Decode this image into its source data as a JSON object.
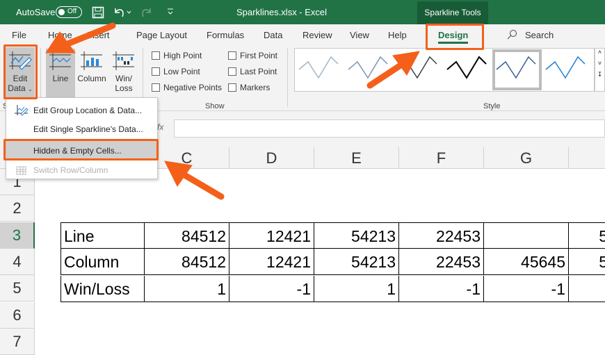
{
  "titlebar": {
    "autosave_label": "AutoSave",
    "autosave_state": "Off",
    "file_title": "Sparklines.xlsx  -  Excel",
    "context_tab": "Sparkline Tools"
  },
  "tabs": [
    {
      "label": "File"
    },
    {
      "label": "Home"
    },
    {
      "label": "Insert"
    },
    {
      "label": "Page Layout"
    },
    {
      "label": "Formulas"
    },
    {
      "label": "Data"
    },
    {
      "label": "Review"
    },
    {
      "label": "View"
    },
    {
      "label": "Help"
    },
    {
      "label": "Design",
      "active": true
    }
  ],
  "search": {
    "label": "Search"
  },
  "ribbon": {
    "edit_data": {
      "line1": "Edit",
      "line2": "Data"
    },
    "type": {
      "line": "Line",
      "column": "Column",
      "winloss1": "Win/",
      "winloss2": "Loss"
    },
    "show": {
      "label": "Show",
      "options": [
        {
          "label": "High Point",
          "checked": false
        },
        {
          "label": "Low Point",
          "checked": false
        },
        {
          "label": "Negative Points",
          "checked": false
        },
        {
          "label": "First Point",
          "checked": false
        },
        {
          "label": "Last Point",
          "checked": false
        },
        {
          "label": "Markers",
          "checked": false
        }
      ]
    },
    "style": {
      "label": "Style",
      "swatch_colors": [
        "#a2b6c6",
        "#7b96b0",
        "#404040",
        "#000000",
        "#3b5f94",
        "#1f7fd0"
      ],
      "selected_index": 4
    },
    "group_label_partial": "S"
  },
  "menu": {
    "items": [
      {
        "label": "Edit Group Location & Data...",
        "icon": "edit-sparkline-icon",
        "enabled": true
      },
      {
        "label": "Edit Single Sparkline's Data...",
        "enabled": true
      },
      {
        "label": "Hidden & Empty Cells...",
        "enabled": true,
        "highlighted": true
      },
      {
        "label": "Switch Row/Column",
        "icon": "switch-row-column-icon",
        "enabled": false
      }
    ]
  },
  "formula_bar": {
    "fx": "fx",
    "value": ""
  },
  "columns": [
    "C",
    "D",
    "E",
    "F",
    "G"
  ],
  "rows": [
    "1",
    "2",
    "3",
    "4",
    "5",
    "6",
    "7"
  ],
  "table": [
    {
      "label": "Line",
      "values": [
        "84512",
        "12421",
        "54213",
        "22453",
        "",
        "5"
      ]
    },
    {
      "label": "Column",
      "values": [
        "84512",
        "12421",
        "54213",
        "22453",
        "45645",
        "5"
      ]
    },
    {
      "label": "Win/Loss",
      "values": [
        "1",
        "-1",
        "1",
        "-1",
        "-1",
        ""
      ]
    }
  ],
  "colors": {
    "excel_green": "#217346",
    "annotation_orange": "#f4601a"
  }
}
